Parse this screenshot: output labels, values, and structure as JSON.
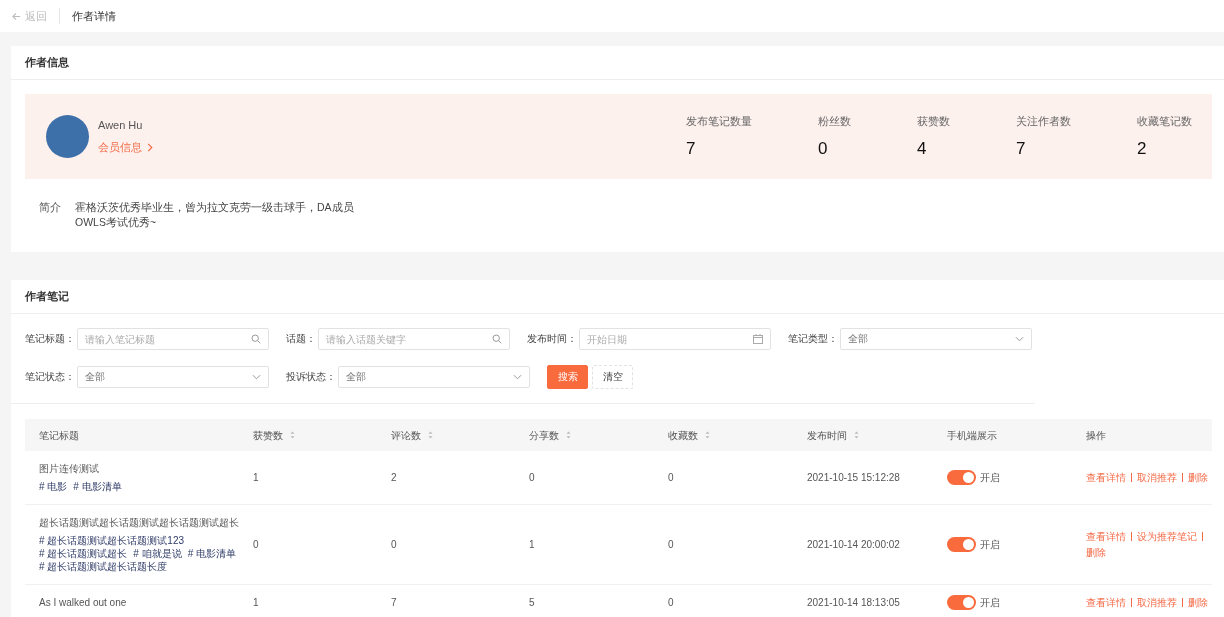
{
  "header": {
    "back": "返回",
    "title": "作者详情"
  },
  "author_section": {
    "title": "作者信息",
    "name": "Awen Hu",
    "member_link": "会员信息",
    "stats": [
      {
        "label": "发布笔记数量",
        "value": "7"
      },
      {
        "label": "粉丝数",
        "value": "0"
      },
      {
        "label": "获赞数",
        "value": "4"
      },
      {
        "label": "关注作者数",
        "value": "7"
      },
      {
        "label": "收藏笔记数",
        "value": "2"
      }
    ],
    "intro_label": "简介",
    "intro_lines": [
      "霍格沃茨优秀毕业生，曾为拉文克劳一级击球手，DA成员",
      "OWLS考试优秀~"
    ]
  },
  "notes_section": {
    "title": "作者笔记",
    "filters": [
      {
        "label": "笔记标题：",
        "kind": "search",
        "placeholder": "请输入笔记标题"
      },
      {
        "label": "话题：",
        "kind": "search",
        "placeholder": "请输入话题关键字"
      },
      {
        "label": "发布时间：",
        "kind": "date",
        "placeholder": "开始日期"
      },
      {
        "label": "笔记类型：",
        "kind": "select",
        "value": "全部"
      },
      {
        "label": "笔记状态：",
        "kind": "select",
        "value": "全部"
      },
      {
        "label": "投诉状态：",
        "kind": "select",
        "value": "全部"
      }
    ],
    "buttons": [
      {
        "label": "搜索",
        "kind": "primary"
      },
      {
        "label": "清空",
        "kind": "plain"
      }
    ],
    "table": {
      "columns": [
        {
          "label": "笔记标题",
          "sortable": false
        },
        {
          "label": "获赞数",
          "sortable": true
        },
        {
          "label": "评论数",
          "sortable": true
        },
        {
          "label": "分享数",
          "sortable": true
        },
        {
          "label": "收藏数",
          "sortable": true
        },
        {
          "label": "发布时间",
          "sortable": true
        },
        {
          "label": "手机端展示",
          "sortable": false
        },
        {
          "label": "操作",
          "sortable": false
        }
      ],
      "rows": [
        {
          "title": "图片连传测试",
          "tags": [
            "# 电影",
            "# 电影清单"
          ],
          "likes": "1",
          "comments": "2",
          "shares": "0",
          "favorites": "0",
          "published": "2021-10-15 15:12:28",
          "mobile_display": {
            "on": true,
            "label": "开启"
          },
          "actions": [
            "查看详情",
            "取消推荐",
            "删除"
          ]
        },
        {
          "title": "超长话题测试超长话题测试超长话题测试超长",
          "tags": [
            "# 超长话题测试超长话题测试123",
            "# 超长话题测试超长",
            "# 咱就是说",
            "# 电影清单",
            "# 超长话题测试超长话题长度"
          ],
          "likes": "0",
          "comments": "0",
          "shares": "1",
          "favorites": "0",
          "published": "2021-10-14 20:00:02",
          "mobile_display": {
            "on": true,
            "label": "开启"
          },
          "actions": [
            "查看详情",
            "设为推荐笔记",
            "删除"
          ]
        },
        {
          "title": "As I walked out one",
          "likes": "1",
          "comments": "7",
          "shares": "5",
          "favorites": "0",
          "published": "2021-10-14 18:13:05",
          "mobile_display": {
            "on": true,
            "label": "开启"
          },
          "actions": [
            "查看详情",
            "取消推荐",
            "删除"
          ]
        }
      ]
    }
  }
}
